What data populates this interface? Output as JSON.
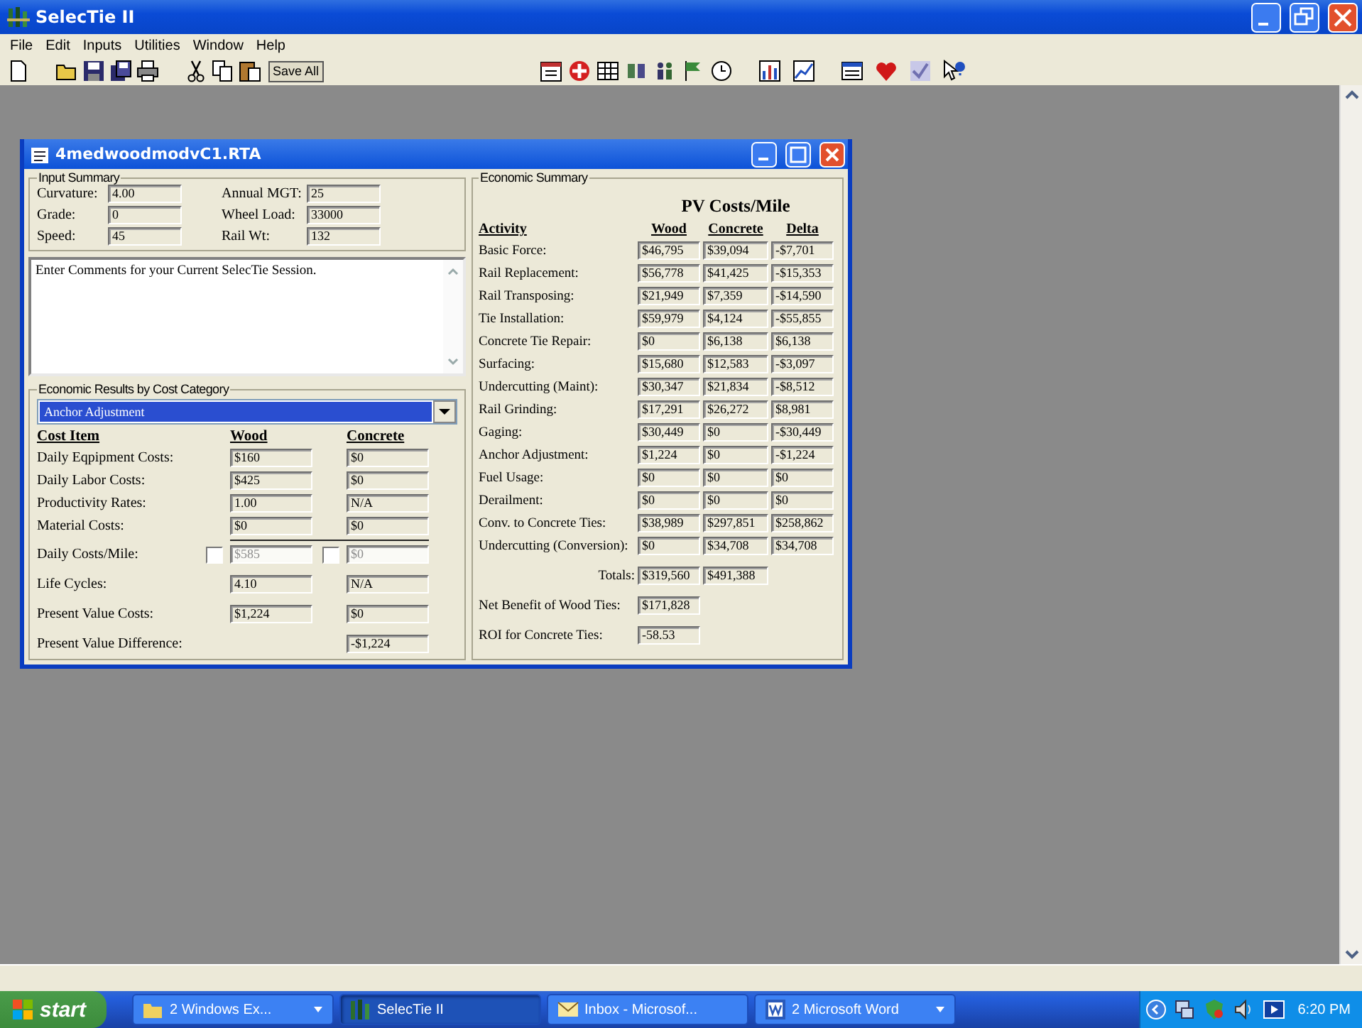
{
  "window": {
    "title": "SelecTie II"
  },
  "menu": [
    "File",
    "Edit",
    "Inputs",
    "Utilities",
    "Window",
    "Help"
  ],
  "toolbar": {
    "save_all": "Save All"
  },
  "document": {
    "title": "4medwoodmodvC1.RTA",
    "input_summary": {
      "title": "Input Summary",
      "rows": [
        [
          {
            "label": "Curvature:",
            "value": "4.00"
          },
          {
            "label": "Annual MGT:",
            "value": "25"
          }
        ],
        [
          {
            "label": "Grade:",
            "value": "0"
          },
          {
            "label": "Wheel Load:",
            "value": "33000"
          }
        ],
        [
          {
            "label": "Speed:",
            "value": "45"
          },
          {
            "label": "Rail Wt:",
            "value": "132"
          }
        ]
      ]
    },
    "comments": "Enter Comments for your Current SelecTie Session.",
    "cost_category": {
      "title": "Economic Results by Cost Category",
      "selected": "Anchor Adjustment",
      "columns": [
        "Cost Item",
        "Wood",
        "Concrete"
      ],
      "rows": [
        {
          "label": "Daily Eqpipment Costs:",
          "wood": "$160",
          "concrete": "$0"
        },
        {
          "label": "Daily Labor Costs:",
          "wood": "$425",
          "concrete": "$0"
        },
        {
          "label": "Productivity Rates:",
          "wood": "1.00",
          "concrete": "N/A"
        },
        {
          "label": "Material Costs:",
          "wood": "$0",
          "concrete": "$0"
        }
      ],
      "daily_costs": {
        "label": "Daily Costs/Mile:",
        "wood": {
          "checked": false,
          "value": "$585"
        },
        "concrete": {
          "checked": false,
          "value": "$0"
        }
      },
      "life_cycles": {
        "label": "Life Cycles:",
        "wood": "4.10",
        "concrete": "N/A"
      },
      "pv_costs": {
        "label": "Present Value Costs:",
        "wood": "$1,224",
        "concrete": "$0"
      },
      "pv_difference": {
        "label": "Present Value Difference:",
        "value": "-$1,224"
      }
    },
    "summary": {
      "title": "Economic Summary",
      "heading": "PV Costs/Mile",
      "columns": [
        "Activity",
        "Wood",
        "Concrete",
        "Delta"
      ],
      "rows": [
        {
          "label": "Basic Force:",
          "wood": "$46,795",
          "concrete": "$39,094",
          "delta": "-$7,701"
        },
        {
          "label": "Rail Replacement:",
          "wood": "$56,778",
          "concrete": "$41,425",
          "delta": "-$15,353"
        },
        {
          "label": "Rail Transposing:",
          "wood": "$21,949",
          "concrete": "$7,359",
          "delta": "-$14,590"
        },
        {
          "label": "Tie Installation:",
          "wood": "$59,979",
          "concrete": "$4,124",
          "delta": "-$55,855"
        },
        {
          "label": "Concrete  Tie Repair:",
          "wood": "$0",
          "concrete": "$6,138",
          "delta": "$6,138"
        },
        {
          "label": "Surfacing:",
          "wood": "$15,680",
          "concrete": "$12,583",
          "delta": "-$3,097"
        },
        {
          "label": "Undercutting (Maint):",
          "wood": "$30,347",
          "concrete": "$21,834",
          "delta": "-$8,512"
        },
        {
          "label": "Rail Grinding:",
          "wood": "$17,291",
          "concrete": "$26,272",
          "delta": "$8,981"
        },
        {
          "label": "Gaging:",
          "wood": "$30,449",
          "concrete": "$0",
          "delta": "-$30,449"
        },
        {
          "label": "Anchor Adjustment:",
          "wood": "$1,224",
          "concrete": "$0",
          "delta": "-$1,224"
        },
        {
          "label": "Fuel Usage:",
          "wood": "$0",
          "concrete": "$0",
          "delta": "$0"
        },
        {
          "label": "Derailment:",
          "wood": "$0",
          "concrete": "$0",
          "delta": "$0"
        },
        {
          "label": "Conv. to Concrete  Ties:",
          "wood": "$38,989",
          "concrete": "$297,851",
          "delta": "$258,862"
        },
        {
          "label": "Undercutting (Conversion):",
          "wood": "$0",
          "concrete": "$34,708",
          "delta": "$34,708"
        }
      ],
      "totals": {
        "label": "Totals:",
        "wood": "$319,560",
        "concrete": "$491,388"
      },
      "net_benefit": {
        "label": "Net Benefit of Wood Ties:",
        "value": "$171,828"
      },
      "roi": {
        "label": "ROI for Concrete  Ties:",
        "value": "-58.53"
      }
    }
  },
  "taskbar": {
    "start": "start",
    "tasks": [
      {
        "label": "2 Windows Ex...",
        "kind": "folder",
        "group": true,
        "selected": false
      },
      {
        "label": "SelecTie II",
        "kind": "app",
        "group": false,
        "selected": true
      },
      {
        "label": "Inbox - Microsof...",
        "kind": "mail",
        "group": false,
        "selected": false
      },
      {
        "label": "2 Microsoft Word",
        "kind": "word",
        "group": true,
        "selected": false
      }
    ],
    "clock": "6:20 PM"
  }
}
